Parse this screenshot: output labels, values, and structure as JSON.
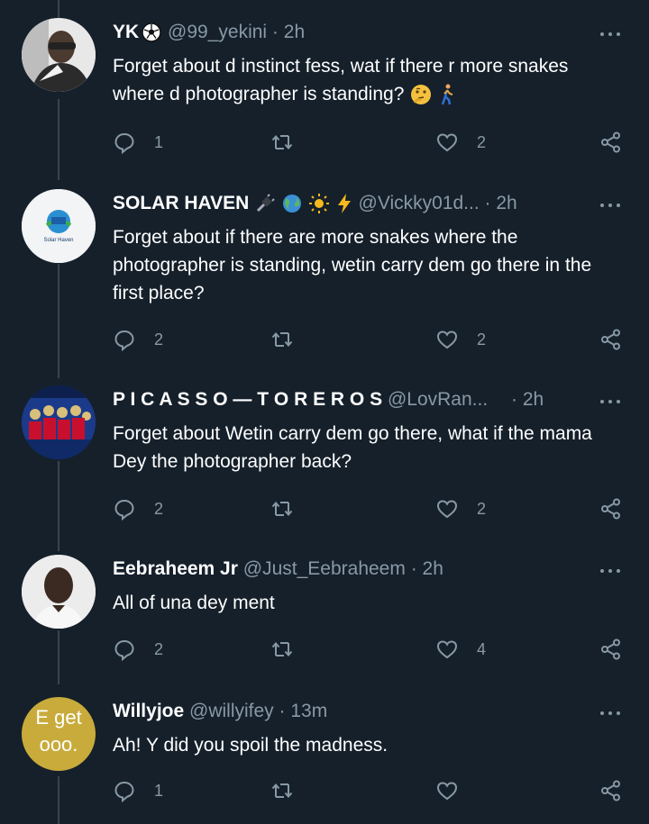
{
  "tweets": [
    {
      "name": "YK",
      "handle": "@99_yekini",
      "time": "2h",
      "text": "Forget about d instinct fess, wat if there r more snakes where d photographer is standing?",
      "reply_count": "1",
      "retweet_count": "",
      "like_count": "2"
    },
    {
      "name": "SOLAR HAVEN",
      "handle": "@Vickky01d...",
      "time": "2h",
      "text": "Forget about if there are more snakes where the photographer is standing, wetin carry dem go there in the first place?",
      "reply_count": "2",
      "retweet_count": "",
      "like_count": "2",
      "avatar_text": "Solar Haven"
    },
    {
      "name": "P I C A S S O — T O R E R O S",
      "handle": "@LovRan...",
      "time": "2h",
      "text": "Forget about Wetin carry dem go there, what if the mama Dey the photographer back?",
      "reply_count": "2",
      "retweet_count": "",
      "like_count": "2"
    },
    {
      "name": "Eebraheem Jr",
      "handle": "@Just_Eebraheem",
      "time": "2h",
      "text": "All of una dey ment",
      "reply_count": "2",
      "retweet_count": "",
      "like_count": "4"
    },
    {
      "name": "Willyjoe",
      "handle": "@willyifey",
      "time": "13m",
      "text": "Ah! Y did you spoil the madness.",
      "reply_count": "1",
      "retweet_count": "",
      "like_count": "",
      "avatar_text": "E get ooo."
    }
  ],
  "separator": "·",
  "colors": {
    "background": "#15202b",
    "secondary_text": "#8899a6",
    "thread_line": "#38444d",
    "avatar_yellow": "#c8ab3b"
  }
}
